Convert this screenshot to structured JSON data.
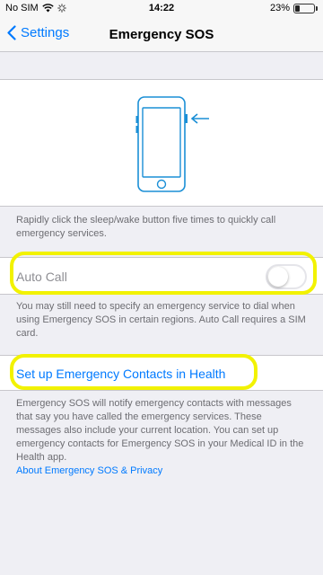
{
  "status_bar": {
    "carrier": "No SIM",
    "time": "14:22",
    "battery": "23%",
    "battery_level": 0.23
  },
  "nav": {
    "back_label": "Settings",
    "title": "Emergency SOS"
  },
  "captions": {
    "intro": "Rapidly click the sleep/wake button five times to quickly call emergency services.",
    "auto_call_note": "You may still need to specify an emergency service to dial when using Emergency SOS in certain regions. Auto Call requires a SIM card.",
    "contacts_note": "Emergency SOS will notify emergency contacts with messages that say you have called the emergency services. These messages also include your current location. You can set up emergency contacts for Emergency SOS in your Medical ID in the Health app.",
    "privacy_link": "About Emergency SOS & Privacy"
  },
  "auto_call": {
    "label": "Auto Call",
    "enabled": false
  },
  "contacts": {
    "link_label": "Set up Emergency Contacts in Health"
  },
  "colors": {
    "accent": "#007aff",
    "highlight": "#f2f200",
    "background": "#efeff4"
  },
  "icons": {
    "back": "chevron-left-icon",
    "wifi": "wifi-icon",
    "loading": "spinner-icon",
    "phone": "phone-illustration-icon",
    "arrow": "arrow-left-icon"
  }
}
